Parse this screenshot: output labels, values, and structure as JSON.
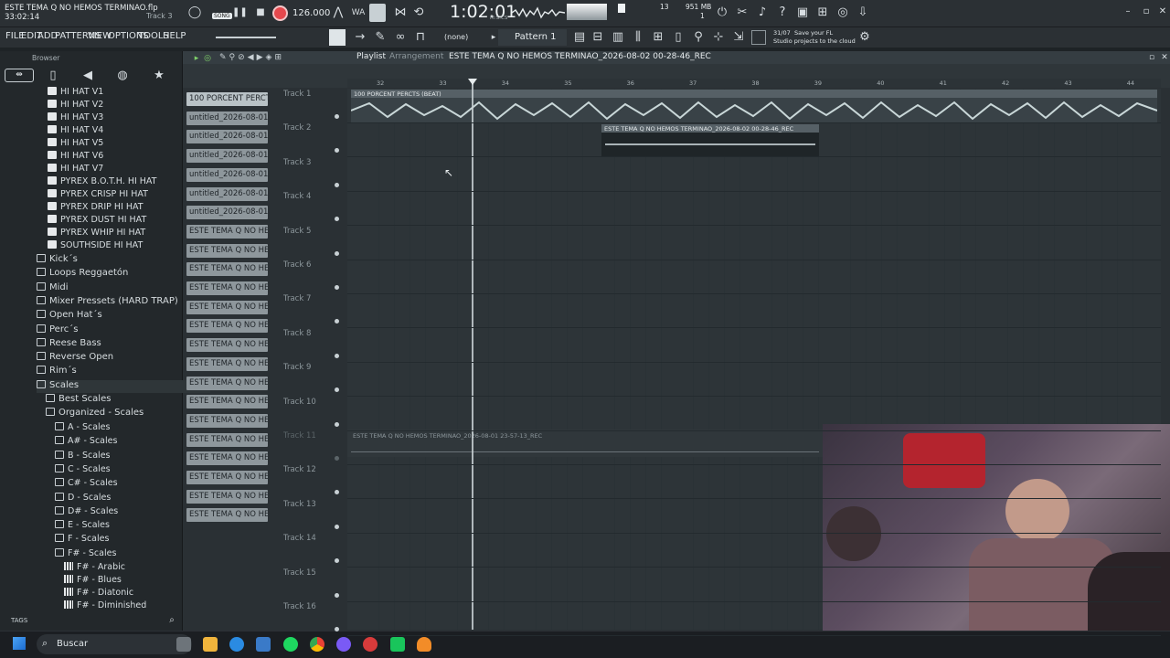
{
  "window": {
    "title": "ESTE TEMA Q NO HEMOS TERMINAO.flp",
    "time_elapsed": "33:02:14",
    "track_hint": "Track 3"
  },
  "transport": {
    "mode_label": "SONG",
    "tempo": "126.000",
    "position": "1:02:01",
    "position_unit": "M:S:CS",
    "cpu_label": "13",
    "memory_label": "951 MB",
    "memory_sub": "1"
  },
  "menu": [
    "FILE",
    "EDIT",
    "ADD",
    "PATTERNS",
    "VIEW",
    "OPTIONS",
    "TOOLS",
    "HELP"
  ],
  "toolbar": {
    "snap_value": "(none)",
    "pattern_name": "Pattern 1",
    "news_date": "31/07",
    "news_text_line1": "Save your FL",
    "news_text_line2": "Studio projects to the cloud"
  },
  "browser": {
    "title": "Browser",
    "tags_label": "TAGS",
    "files": [
      "HI HAT V1",
      "HI HAT V2",
      "HI HAT V3",
      "HI HAT V4",
      "HI HAT V5",
      "HI HAT V6",
      "HI HAT V7",
      "PYREX B.O.T.H. HI HAT",
      "PYREX CRISP HI HAT",
      "PYREX DRIP HI HAT",
      "PYREX DUST HI HAT",
      "PYREX WHIP HI HAT",
      "SOUTHSIDE HI HAT"
    ],
    "folders": [
      "Kick´s",
      "Loops Reggaetón",
      "Midi",
      "Mixer Pressets (HARD TRAP)",
      "Open Hat´s",
      "Perc´s",
      "Reese Bass",
      "Reverse Open",
      "Rim´s",
      "Scales"
    ],
    "scales_children": [
      "Best Scales",
      "Organized - Scales"
    ],
    "scale_keys": [
      "A - Scales",
      "A# - Scales",
      "B - Scales",
      "C - Scales",
      "C# - Scales",
      "D - Scales",
      "D# - Scales",
      "E - Scales",
      "F - Scales",
      "F# - Scales"
    ],
    "fsharp_items": [
      "F# - Arabic",
      "F# - Blues",
      "F# - Diatonic",
      "F# - Diminished"
    ]
  },
  "playlist": {
    "title": "Playlist",
    "subtitle": "Arrangement",
    "recording_name": "ESTE TEMA Q NO HEMOS TERMINAO_2026-08-02 00-28-46_REC",
    "ruler": [
      "32",
      "33",
      "34",
      "35",
      "36",
      "37",
      "38",
      "39",
      "40",
      "41",
      "42",
      "43",
      "44"
    ],
    "patterns": [
      "100 PORCENT PERCTS...",
      "untitled_2026-08-01 23-...",
      "untitled_2026-08-01 23-...",
      "untitled_2026-08-01 23-...",
      "untitled_2026-08-01 23-...",
      "untitled_2026-08-01 23-...",
      "untitled_2026-08-01 23-...",
      "ESTE TEMA Q NO HEMOS T...",
      "ESTE TEMA Q NO HEMOS T...",
      "ESTE TEMA Q NO HEMOS T...",
      "ESTE TEMA Q NO HEMOS T...",
      "ESTE TEMA Q NO HEMOS T...",
      "ESTE TEMA Q NO HEMOS T...",
      "ESTE TEMA Q NO HEMOS T...",
      "ESTE TEMA Q NO HEMOS T...",
      "ESTE TEMA Q NO HEMOS T...",
      "ESTE TEMA Q NO HEMOS T...",
      "ESTE TEMA Q NO HEMOS T...",
      "ESTE TEMA Q NO HEMOS T...",
      "ESTE TEMA Q NO HEMOS T...",
      "ESTE TEMA Q NO HEMOS T...",
      "ESTE TEMA Q NO HEMOS T...",
      "ESTE TEMA Q NO HEMOS T..."
    ],
    "tracks": [
      "Track 1",
      "Track 2",
      "Track 3",
      "Track 4",
      "Track 5",
      "Track 6",
      "Track 7",
      "Track 8",
      "Track 9",
      "Track 10",
      "Track 11",
      "Track 12",
      "Track 13",
      "Track 14",
      "Track 15",
      "Track 16"
    ],
    "clips": {
      "beat": "100 PORCENT PERCTS (BEAT)",
      "rec1": "ESTE TEMA Q NO HEMOS TERMINAO_2026-08-02 00-28-46_REC",
      "rec2": "ESTE TEMA Q NO HEMOS TERMINAO_2026-08-01 23-57-13_REC"
    }
  },
  "taskbar": {
    "search_placeholder": "Buscar"
  },
  "colors": {
    "record": "#e5484d",
    "clip": "#566066",
    "pattern": "#8e979c",
    "accent_green": "#7fd16a"
  }
}
